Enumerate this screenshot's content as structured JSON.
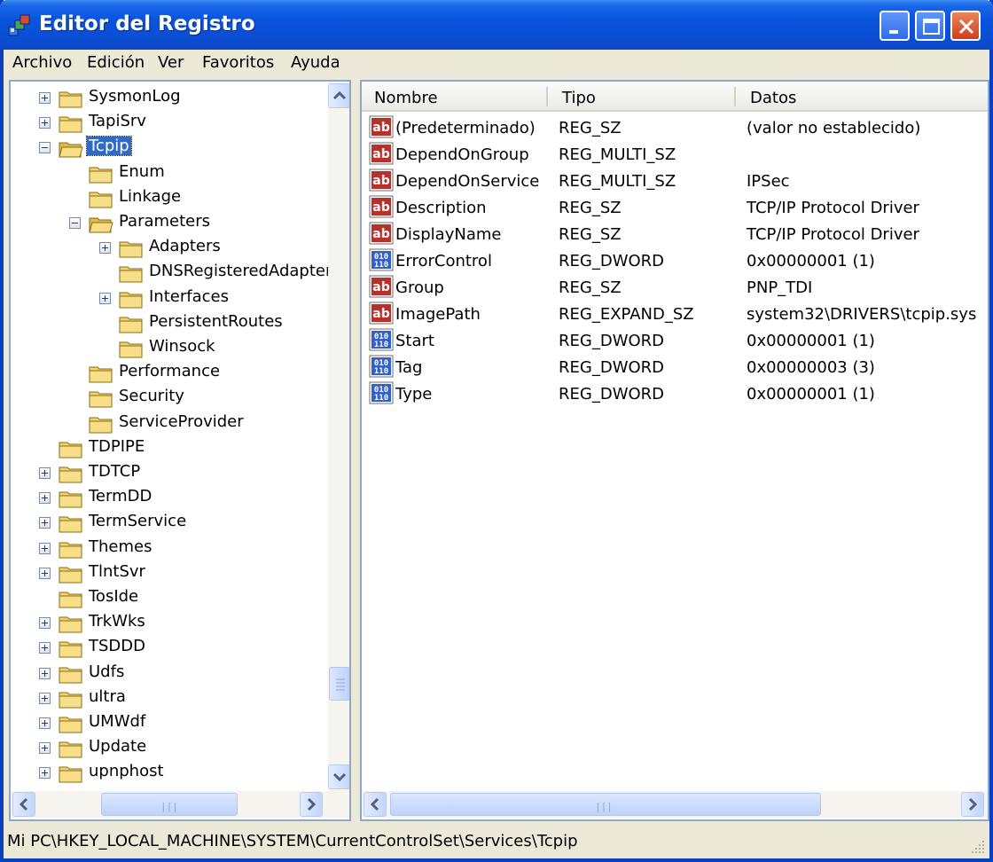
{
  "window": {
    "title": "Editor del Registro"
  },
  "menu": [
    "Archivo",
    "Edición",
    "Ver",
    "Favoritos",
    "Ayuda"
  ],
  "tree": [
    {
      "label": "SysmonLog",
      "level": 0,
      "expander": "plus"
    },
    {
      "label": "TapiSrv",
      "level": 0,
      "expander": "plus"
    },
    {
      "label": "Tcpip",
      "level": 0,
      "expander": "minus",
      "selected": true,
      "open": true
    },
    {
      "label": "Enum",
      "level": 1,
      "expander": "none"
    },
    {
      "label": "Linkage",
      "level": 1,
      "expander": "none"
    },
    {
      "label": "Parameters",
      "level": 1,
      "expander": "minus",
      "open": true
    },
    {
      "label": "Adapters",
      "level": 2,
      "expander": "plus"
    },
    {
      "label": "DNSRegisteredAdapters",
      "level": 2,
      "expander": "none"
    },
    {
      "label": "Interfaces",
      "level": 2,
      "expander": "plus"
    },
    {
      "label": "PersistentRoutes",
      "level": 2,
      "expander": "none"
    },
    {
      "label": "Winsock",
      "level": 2,
      "expander": "none"
    },
    {
      "label": "Performance",
      "level": 1,
      "expander": "none"
    },
    {
      "label": "Security",
      "level": 1,
      "expander": "none"
    },
    {
      "label": "ServiceProvider",
      "level": 1,
      "expander": "none"
    },
    {
      "label": "TDPIPE",
      "level": 0,
      "expander": "none"
    },
    {
      "label": "TDTCP",
      "level": 0,
      "expander": "plus"
    },
    {
      "label": "TermDD",
      "level": 0,
      "expander": "plus"
    },
    {
      "label": "TermService",
      "level": 0,
      "expander": "plus"
    },
    {
      "label": "Themes",
      "level": 0,
      "expander": "plus"
    },
    {
      "label": "TlntSvr",
      "level": 0,
      "expander": "plus"
    },
    {
      "label": "TosIde",
      "level": 0,
      "expander": "none"
    },
    {
      "label": "TrkWks",
      "level": 0,
      "expander": "plus"
    },
    {
      "label": "TSDDD",
      "level": 0,
      "expander": "plus"
    },
    {
      "label": "Udfs",
      "level": 0,
      "expander": "plus"
    },
    {
      "label": "ultra",
      "level": 0,
      "expander": "plus"
    },
    {
      "label": "UMWdf",
      "level": 0,
      "expander": "plus"
    },
    {
      "label": "Update",
      "level": 0,
      "expander": "plus"
    },
    {
      "label": "upnphost",
      "level": 0,
      "expander": "plus"
    }
  ],
  "list": {
    "headers": {
      "name": "Nombre",
      "type": "Tipo",
      "data": "Datos"
    },
    "rows": [
      {
        "name": "(Predeterminado)",
        "type": "REG_SZ",
        "data": "(valor no establecido)",
        "icon": "string-value-icon"
      },
      {
        "name": "DependOnGroup",
        "type": "REG_MULTI_SZ",
        "data": "",
        "icon": "string-value-icon"
      },
      {
        "name": "DependOnService",
        "type": "REG_MULTI_SZ",
        "data": "IPSec",
        "icon": "string-value-icon"
      },
      {
        "name": "Description",
        "type": "REG_SZ",
        "data": "TCP/IP Protocol Driver",
        "icon": "string-value-icon"
      },
      {
        "name": "DisplayName",
        "type": "REG_SZ",
        "data": "TCP/IP Protocol Driver",
        "icon": "string-value-icon"
      },
      {
        "name": "ErrorControl",
        "type": "REG_DWORD",
        "data": "0x00000001 (1)",
        "icon": "binary-value-icon"
      },
      {
        "name": "Group",
        "type": "REG_SZ",
        "data": "PNP_TDI",
        "icon": "string-value-icon"
      },
      {
        "name": "ImagePath",
        "type": "REG_EXPAND_SZ",
        "data": "system32\\DRIVERS\\tcpip.sys",
        "icon": "string-value-icon"
      },
      {
        "name": "Start",
        "type": "REG_DWORD",
        "data": "0x00000001 (1)",
        "icon": "binary-value-icon"
      },
      {
        "name": "Tag",
        "type": "REG_DWORD",
        "data": "0x00000003 (3)",
        "icon": "binary-value-icon"
      },
      {
        "name": "Type",
        "type": "REG_DWORD",
        "data": "0x00000001 (1)",
        "icon": "binary-value-icon"
      }
    ]
  },
  "status": {
    "path": "Mi PC\\HKEY_LOCAL_MACHINE\\SYSTEM\\CurrentControlSet\\Services\\Tcpip"
  },
  "colors": {
    "titlebar": "#0a54dd",
    "selection": "#316ac5",
    "folder": "#f4d36a"
  }
}
